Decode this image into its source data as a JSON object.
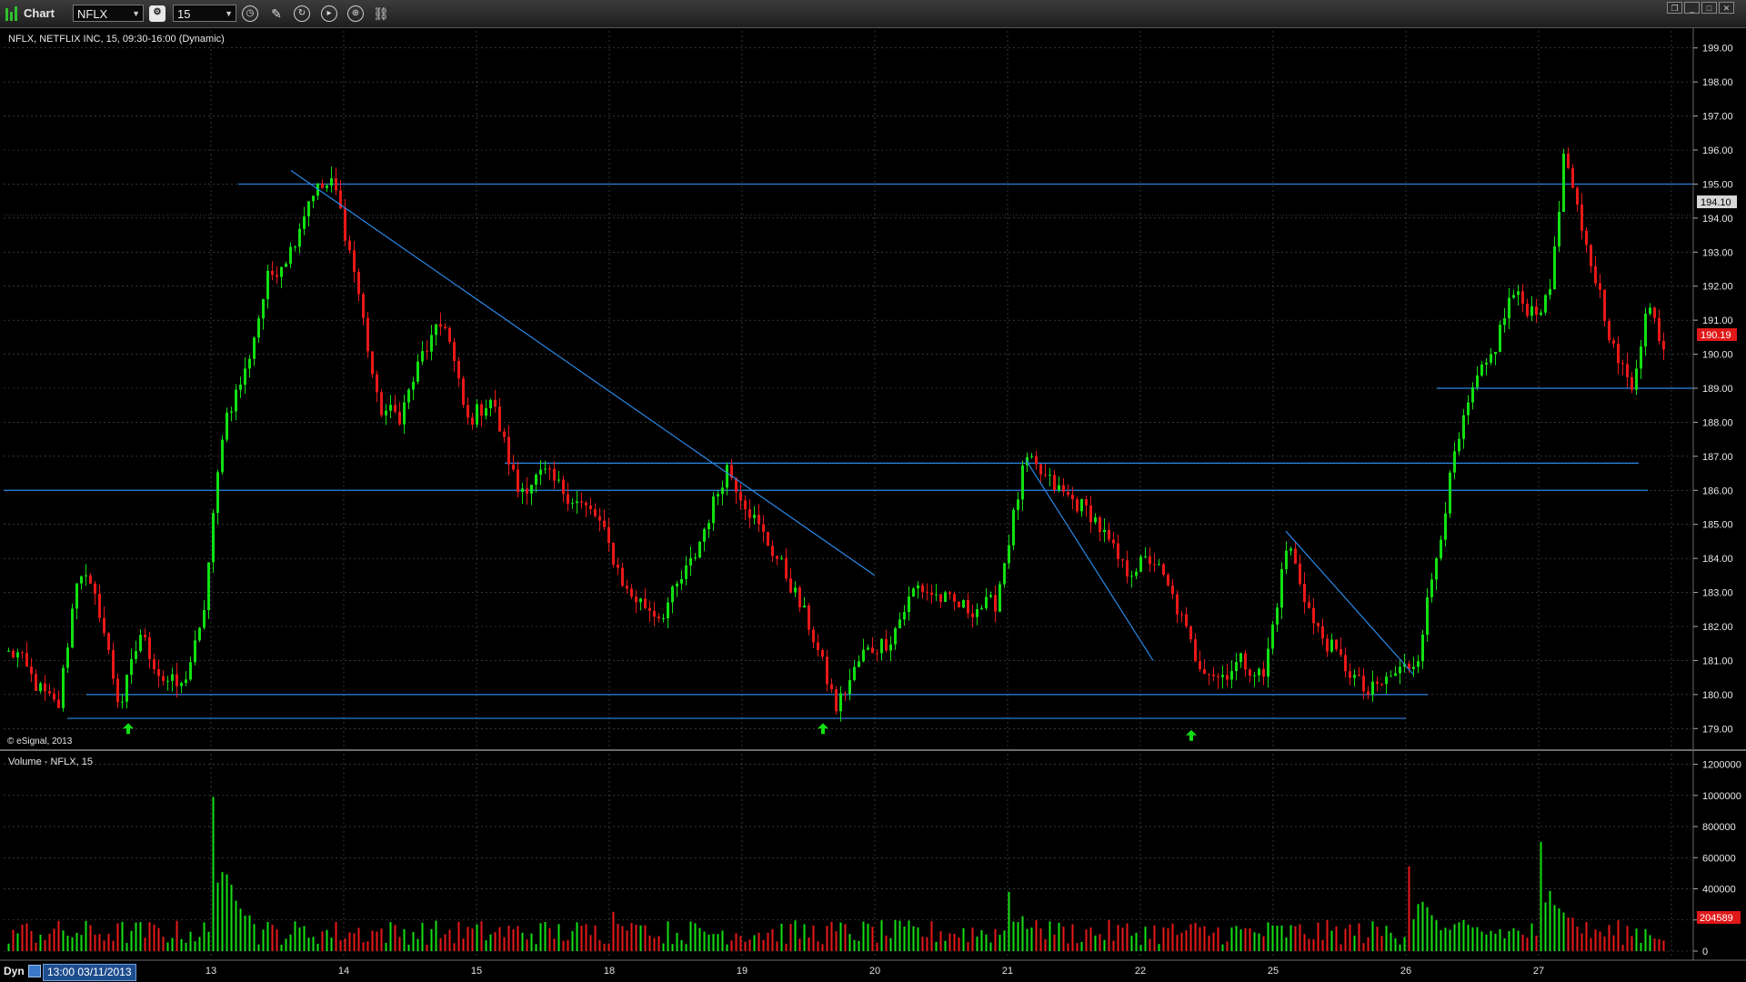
{
  "window": {
    "title": "Chart"
  },
  "toolbar": {
    "symbol_value": "NFLX",
    "interval_value": "15",
    "icons": [
      "settings-icon",
      "clock-icon",
      "pencil-icon",
      "refresh-icon",
      "play-icon",
      "zoom-icon",
      "link-icon"
    ]
  },
  "window_controls": [
    "restore-icon",
    "minimize-icon",
    "maximize-icon",
    "close-icon"
  ],
  "colors": {
    "up": "#12e012",
    "down": "#e81818",
    "line": "#2a88e6",
    "grid": "#555555",
    "accent": "#3a78c8",
    "bg": "#000000"
  },
  "price_panel": {
    "info": "NFLX, NETFLIX INC, 15, 09:30-16:00 (Dynamic)",
    "copyright": "© eSignal, 2013",
    "crosshair_price": "194.10",
    "last_price": "190.19"
  },
  "volume_panel": {
    "info": "Volume - NFLX, 15",
    "last_volume": "204589"
  },
  "status": {
    "mode": "Dyn",
    "cursor_datetime": "13:00 03/11/2013"
  },
  "chart_data": [
    {
      "type": "candlestick",
      "ylim": [
        178.5,
        199.5
      ],
      "y_ticks": [
        "199.00",
        "198.00",
        "197.00",
        "196.00",
        "195.00",
        "194.00",
        "193.00",
        "192.00",
        "191.00",
        "190.00",
        "189.00",
        "188.00",
        "187.00",
        "186.00",
        "185.00",
        "184.00",
        "183.00",
        "182.00",
        "181.00",
        "180.00",
        "179.00"
      ],
      "x_ticks": [
        "13",
        "14",
        "15",
        "18",
        "19",
        "20",
        "21",
        "22",
        "25",
        "26",
        "27"
      ],
      "anchors": [
        [
          "11",
          181.2
        ],
        [
          "11",
          180.2
        ],
        [
          "11",
          179.6
        ],
        [
          "11",
          183.8
        ],
        [
          "11",
          182.5
        ],
        [
          "11",
          179.6
        ],
        [
          "11",
          181.8
        ],
        [
          "11",
          180.5
        ],
        [
          "11",
          180.2
        ],
        [
          "11",
          182.0
        ],
        [
          "13",
          188.0
        ],
        [
          "13",
          189.5
        ],
        [
          "13",
          192.2
        ],
        [
          "13",
          193.0
        ],
        [
          "13",
          194.8
        ],
        [
          "13",
          195.0
        ],
        [
          "14",
          192.2
        ],
        [
          "14",
          188.4
        ],
        [
          "14",
          188.2
        ],
        [
          "14",
          190.0
        ],
        [
          "14",
          191.0
        ],
        [
          "14",
          188.0
        ],
        [
          "15",
          188.7
        ],
        [
          "15",
          186.0
        ],
        [
          "15",
          186.5
        ],
        [
          "15",
          185.8
        ],
        [
          "15",
          185.2
        ],
        [
          "18",
          183.0
        ],
        [
          "18",
          182.3
        ],
        [
          "18",
          184.0
        ],
        [
          "18",
          186.7
        ],
        [
          "19",
          185.0
        ],
        [
          "19",
          183.7
        ],
        [
          "19",
          182.0
        ],
        [
          "19",
          179.6
        ],
        [
          "19",
          181.2
        ],
        [
          "20",
          181.6
        ],
        [
          "20",
          183.2
        ],
        [
          "20",
          182.8
        ],
        [
          "20",
          182.5
        ],
        [
          "20",
          182.7
        ],
        [
          "21",
          186.9
        ],
        [
          "21",
          186.0
        ],
        [
          "21",
          185.3
        ],
        [
          "21",
          183.6
        ],
        [
          "22",
          184.0
        ],
        [
          "22",
          182.7
        ],
        [
          "22",
          181.0
        ],
        [
          "22",
          180.5
        ],
        [
          "22",
          181.0
        ],
        [
          "22",
          180.5
        ],
        [
          "25",
          184.5
        ],
        [
          "25",
          182.0
        ],
        [
          "25",
          181.0
        ],
        [
          "25",
          180.0
        ],
        [
          "25",
          180.6
        ],
        [
          "26",
          181.0
        ],
        [
          "26",
          184.0
        ],
        [
          "26",
          187.0
        ],
        [
          "26",
          189.0
        ],
        [
          "26",
          190.0
        ],
        [
          "26",
          191.8
        ],
        [
          "26",
          191.3
        ],
        [
          "27",
          191.5
        ],
        [
          "27",
          196.0
        ],
        [
          "27",
          193.5
        ],
        [
          "27",
          192.0
        ],
        [
          "27",
          190.0
        ],
        [
          "27",
          189.0
        ],
        [
          "27",
          191.5
        ],
        [
          "27",
          190.2
        ]
      ],
      "horizontal_levels": [
        195.0,
        186.8,
        186.0,
        180.0,
        179.3,
        189.0
      ],
      "trendlines": [
        {
          "from": [
            "13",
            195.4
          ],
          "to": [
            "20",
            183.5
          ]
        },
        {
          "from": [
            "21",
            186.9
          ],
          "to": [
            "22",
            181.0
          ]
        },
        {
          "from": [
            "25",
            184.8
          ],
          "to": [
            "26",
            180.6
          ]
        }
      ],
      "markers": [
        {
          "x": "11",
          "y": 179.0
        },
        {
          "x": "19",
          "y": 179.0
        },
        {
          "x": "22",
          "y": 178.8
        }
      ]
    },
    {
      "type": "bar",
      "title": "Volume - NFLX, 15",
      "ylim": [
        0,
        1250000
      ],
      "y_ticks": [
        "1200000",
        "1000000",
        "800000",
        "600000",
        "400000",
        "200000",
        "0"
      ],
      "x_ticks": [
        "13",
        "14",
        "15",
        "18",
        "19",
        "20",
        "21",
        "22",
        "25",
        "26",
        "27"
      ],
      "spikes": [
        {
          "x": "13",
          "value": 1100000
        },
        {
          "x": "18",
          "value": 360000
        },
        {
          "x": "21",
          "value": 380000
        },
        {
          "x": "26",
          "value": 680000
        },
        {
          "x": "27",
          "value": 780000
        }
      ],
      "last_value": 204589
    }
  ]
}
